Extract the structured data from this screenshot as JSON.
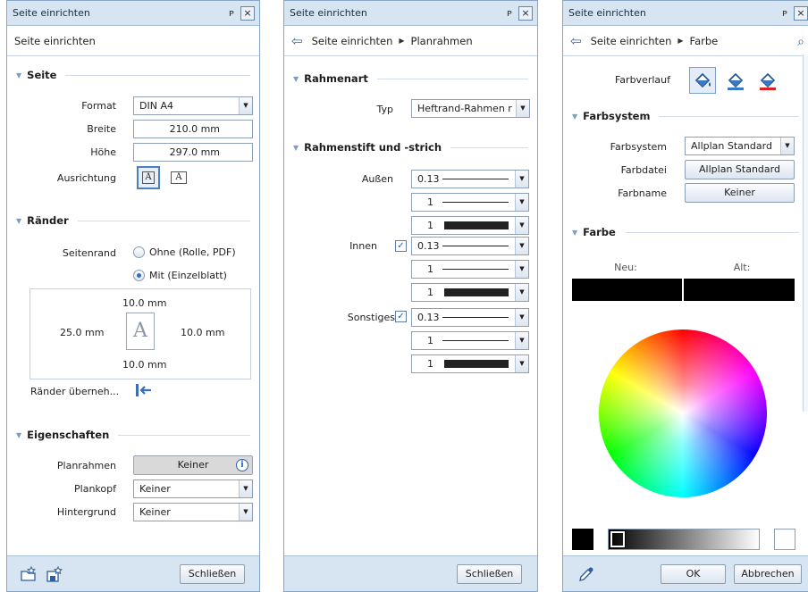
{
  "panel1": {
    "title": "Seite einrichten",
    "pin": "ᵖ",
    "close": "×",
    "header": "Seite einrichten",
    "section_seite": "Seite",
    "format_label": "Format",
    "format_value": "DIN A4",
    "breite_label": "Breite",
    "breite_value": "210.0 mm",
    "hoehe_label": "Höhe",
    "hoehe_value": "297.0 mm",
    "ausrichtung_label": "Ausrichtung",
    "portrait_glyph": "A",
    "landscape_glyph": "A",
    "section_raender": "Ränder",
    "seitenrand_label": "Seitenrand",
    "radio_ohne": "Ohne (Rolle, PDF)",
    "radio_mit": "Mit (Einzelblatt)",
    "margin_top": "10.0 mm",
    "margin_left": "25.0 mm",
    "margin_right": "10.0 mm",
    "margin_bottom": "10.0 mm",
    "page_glyph": "A",
    "raender_uebernehmen": "Ränder überneh...",
    "section_eigenschaften": "Eigenschaften",
    "planrahmen_label": "Planrahmen",
    "planrahmen_value": "Keiner",
    "plankopf_label": "Plankopf",
    "plankopf_value": "Keiner",
    "hintergrund_label": "Hintergrund",
    "hintergrund_value": "Keiner",
    "close_button": "Schließen"
  },
  "panel2": {
    "title": "Seite einrichten",
    "pin": "ᵖ",
    "close": "×",
    "crumb1": "Seite einrichten",
    "crumb2": "Planrahmen",
    "section_rahmenart": "Rahmenart",
    "typ_label": "Typ",
    "typ_value": "Heftrand-Rahmen r",
    "section_stift": "Rahmenstift und -strich",
    "aussen_label": "Außen",
    "innen_label": "Innen",
    "sonstiges_label": "Sonstiges",
    "groups": [
      {
        "pen": "0.13",
        "line": "1",
        "color": "1"
      },
      {
        "pen": "0.13",
        "line": "1",
        "color": "1"
      },
      {
        "pen": "0.13",
        "line": "1",
        "color": "1"
      }
    ],
    "innen_checked": "✓",
    "sonstiges_checked": "✓",
    "close_button": "Schließen"
  },
  "panel3": {
    "title": "Seite einrichten",
    "pin": "ᵖ",
    "close": "×",
    "crumb1": "Seite einrichten",
    "crumb2": "Farbe",
    "farbverlauf_label": "Farbverlauf",
    "section_farbsystem": "Farbsystem",
    "farbsystem_label": "Farbsystem",
    "farbsystem_value": "Allplan Standard",
    "farbdatei_label": "Farbdatei",
    "farbdatei_value": "Allplan Standard",
    "farbname_label": "Farbname",
    "farbname_value": "Keiner",
    "section_farbe": "Farbe",
    "neu_label": "Neu:",
    "alt_label": "Alt:",
    "ok_button": "OK",
    "cancel_button": "Abbrechen"
  },
  "colors": {
    "accent": "#4c7fbd",
    "titlebar": "#d7e4f2",
    "black_swatch": "#000000"
  }
}
